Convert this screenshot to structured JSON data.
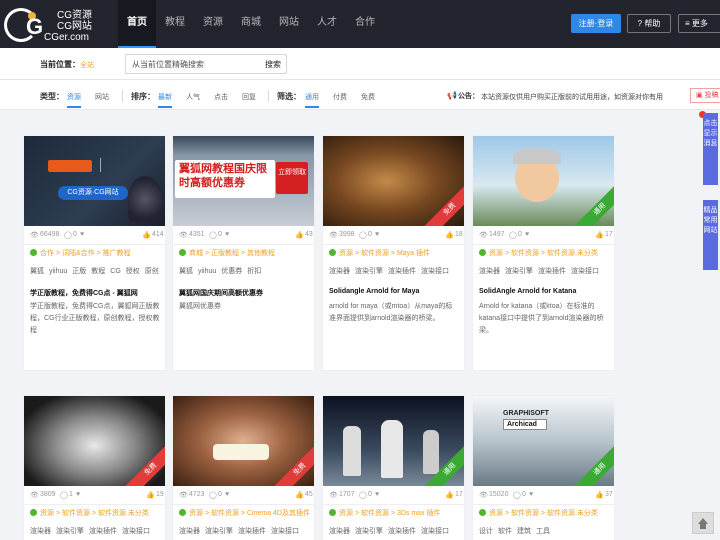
{
  "brand": {
    "line1": "CG资源",
    "line2": "CG网站",
    "line3": "CGer.com",
    "letter": "G"
  },
  "nav": {
    "items": [
      "首页",
      "教程",
      "资源",
      "商城",
      "网站",
      "人才",
      "合作"
    ],
    "register": "注册·登录",
    "help": "? 帮助",
    "more": "≡ 更多"
  },
  "location": {
    "label": "当前位置：",
    "value": "全站",
    "search_placeholder": "从当前位置精确搜索",
    "search_btn": "搜索"
  },
  "filters": {
    "type_label": "类型：",
    "type_options": [
      "资源",
      "网站"
    ],
    "sort_label": "排序：",
    "sort_options": [
      "最新",
      "人气",
      "点击",
      "回复"
    ],
    "filter_label": "筛选：",
    "filter_options": [
      "通用",
      "付费",
      "免费"
    ],
    "notice_label": "公告：",
    "notice_text": "本站资源仅供用户购买正版前的试用用途，如资源对你有用",
    "report": "投稿"
  },
  "colors": {
    "accent": "#2f88e8",
    "nav_bg": "#23252e",
    "tag_green": "#52b52e",
    "crumb": "#f0a020",
    "badge_free": "#e23b3b",
    "badge_general": "#3aaa35"
  },
  "cards": [
    {
      "views": "66498",
      "comments": "0",
      "likes": "414",
      "crumb": "合作 > 词陆&合作 > 推广教程",
      "tags": [
        "翼狐",
        "yiihuu",
        "正版",
        "教程",
        "CG",
        "授权",
        "原创"
      ],
      "title": "学正版教程，免费得CG点 - 翼狐网",
      "desc": "学正版教程，免费得CG点，翼狐网正版教程，CG行业正版教程，原创教程，授权教程",
      "thumb_text": "CG资源·CG网站",
      "badge": ""
    },
    {
      "views": "4351",
      "comments": "0",
      "likes": "43",
      "crumb": "商城 > 正版教程 > 其他教程",
      "tags": [
        "翼狐",
        "yiihuu",
        "优惠券",
        "折扣"
      ],
      "title": "翼狐网国庆期间高额优惠券",
      "desc": "翼狐网优惠券",
      "thumb_text": "翼狐网教程国庆限时高额优惠券",
      "thumb_btn": "立即领取",
      "badge": ""
    },
    {
      "views": "3998",
      "comments": "0",
      "likes": "18",
      "crumb": "资源 > 软件资源 > Maya 插件",
      "tags": [
        "渲染器",
        "渲染引擎",
        "渲染插件",
        "渲染接口"
      ],
      "title": "Solidangle Arnold for Maya",
      "desc": "arnold for maya（或mtoa）从maya的标准界面提供到arnold渲染器的桥梁。",
      "badge": "免费"
    },
    {
      "views": "1497",
      "comments": "0",
      "likes": "17",
      "crumb": "资源 > 软件资源 > 软件资源.未分类",
      "tags": [
        "渲染器",
        "渲染引擎",
        "渲染插件",
        "渲染接口"
      ],
      "title": "SolidAngle Arnold for Katana",
      "desc": "Arnold for katana（或ktoa）在标准的katana接口中提供了到arnold渲染器的桥梁。",
      "badge": "通用"
    },
    {
      "views": "3809",
      "comments": "1",
      "likes": "19",
      "crumb": "资源 > 软件资源 > 软件资源.未分类",
      "tags": [
        "渲染器",
        "渲染引擎",
        "渲染插件",
        "渲染接口"
      ],
      "badge": "免费"
    },
    {
      "views": "4723",
      "comments": "0",
      "likes": "45",
      "crumb": "资源 > 软件资源 > Cinema 4D及其插件",
      "tags": [
        "渲染器",
        "渲染引擎",
        "渲染插件",
        "渲染接口"
      ],
      "badge": "免费"
    },
    {
      "views": "1707",
      "comments": "0",
      "likes": "17",
      "crumb": "资源 > 软件资源 > 3Ds max 插件",
      "tags": [
        "渲染器",
        "渲染引擎",
        "渲染插件",
        "渲染接口"
      ],
      "badge": "通用"
    },
    {
      "views": "15020",
      "comments": "0",
      "likes": "37",
      "crumb": "资源 > 软件资源 > 软件资源.未分类",
      "tags": [
        "设计",
        "软件",
        "建筑",
        "工具"
      ],
      "badge": "通用",
      "thumb_text": "GRAPHISOFT",
      "thumb_text2": "Archicad"
    }
  ],
  "side": {
    "tab1": "点击显示消息",
    "tab2": "精品常用网站"
  }
}
